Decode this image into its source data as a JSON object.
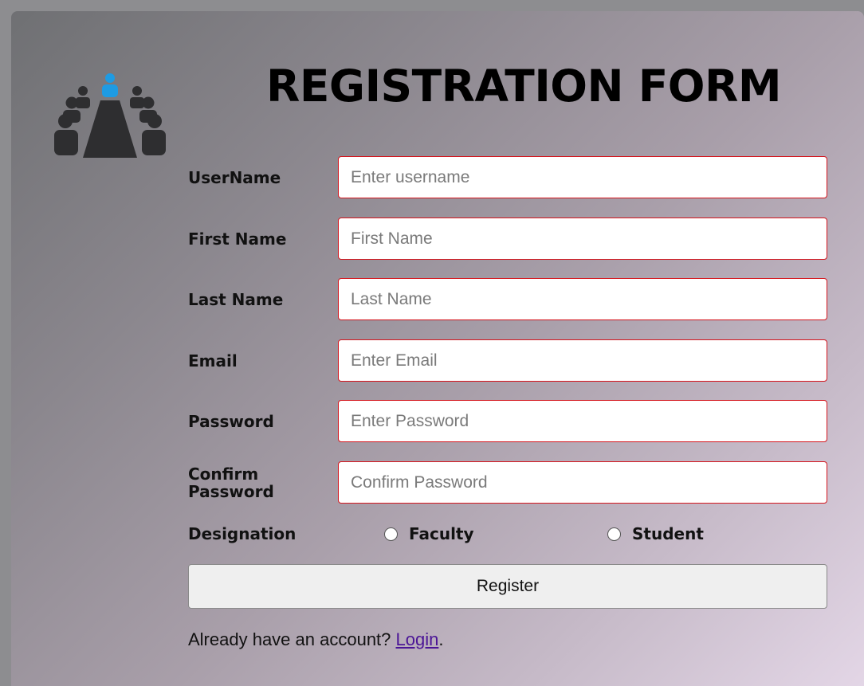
{
  "form": {
    "title": "REGISTRATION FORM",
    "fields": [
      {
        "label": "UserName",
        "placeholder": "Enter username",
        "value": ""
      },
      {
        "label": "First Name",
        "placeholder": "First Name",
        "value": ""
      },
      {
        "label": "Last Name",
        "placeholder": "Last Name",
        "value": ""
      },
      {
        "label": "Email",
        "placeholder": "Enter Email",
        "value": ""
      },
      {
        "label": "Password",
        "placeholder": "Enter Password",
        "value": ""
      },
      {
        "label": "Confirm Password",
        "placeholder": "Confirm Password",
        "value": ""
      }
    ],
    "designation": {
      "label": "Designation",
      "options": [
        {
          "label": "Faculty",
          "selected": false
        },
        {
          "label": "Student",
          "selected": false
        }
      ]
    },
    "register_label": "Register",
    "footer": {
      "text": "Already have an account? ",
      "link": "Login",
      "suffix": "."
    }
  },
  "colors": {
    "input_border": "#d4141c",
    "link": "#4b1596",
    "logo_accent": "#1e9be3",
    "logo_dark": "#2e2e30"
  },
  "icons": {
    "logo": "meeting-table-icon"
  }
}
